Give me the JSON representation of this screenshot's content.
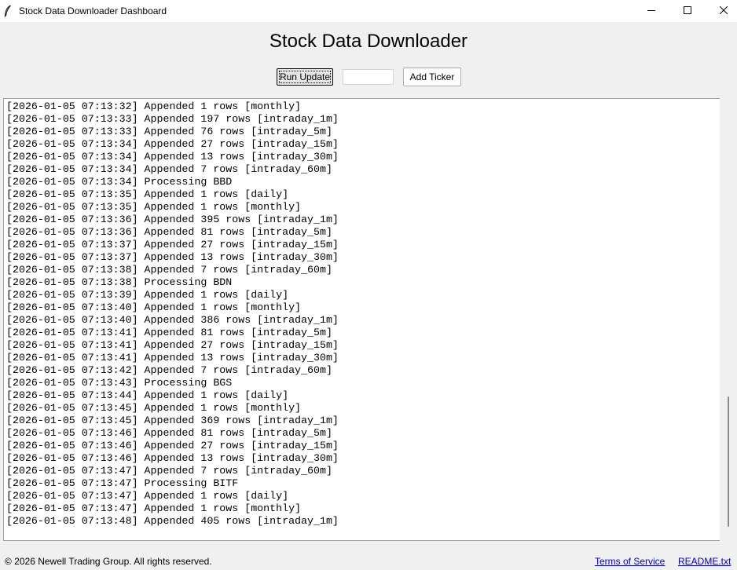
{
  "window": {
    "title": "Stock Data Downloader Dashboard"
  },
  "header": {
    "title": "Stock Data Downloader"
  },
  "toolbar": {
    "run_label": "Run Update",
    "ticker_value": "",
    "add_label": "Add Ticker"
  },
  "log": {
    "lines": [
      "[2026-01-05 07:13:32] Appended 1 rows [monthly]",
      "[2026-01-05 07:13:33] Appended 197 rows [intraday_1m]",
      "[2026-01-05 07:13:33] Appended 76 rows [intraday_5m]",
      "[2026-01-05 07:13:34] Appended 27 rows [intraday_15m]",
      "[2026-01-05 07:13:34] Appended 13 rows [intraday_30m]",
      "[2026-01-05 07:13:34] Appended 7 rows [intraday_60m]",
      "[2026-01-05 07:13:34] Processing BBD",
      "[2026-01-05 07:13:35] Appended 1 rows [daily]",
      "[2026-01-05 07:13:35] Appended 1 rows [monthly]",
      "[2026-01-05 07:13:36] Appended 395 rows [intraday_1m]",
      "[2026-01-05 07:13:36] Appended 81 rows [intraday_5m]",
      "[2026-01-05 07:13:37] Appended 27 rows [intraday_15m]",
      "[2026-01-05 07:13:37] Appended 13 rows [intraday_30m]",
      "[2026-01-05 07:13:38] Appended 7 rows [intraday_60m]",
      "[2026-01-05 07:13:38] Processing BDN",
      "[2026-01-05 07:13:39] Appended 1 rows [daily]",
      "[2026-01-05 07:13:40] Appended 1 rows [monthly]",
      "[2026-01-05 07:13:40] Appended 386 rows [intraday_1m]",
      "[2026-01-05 07:13:41] Appended 81 rows [intraday_5m]",
      "[2026-01-05 07:13:41] Appended 27 rows [intraday_15m]",
      "[2026-01-05 07:13:41] Appended 13 rows [intraday_30m]",
      "[2026-01-05 07:13:42] Appended 7 rows [intraday_60m]",
      "[2026-01-05 07:13:43] Processing BGS",
      "[2026-01-05 07:13:44] Appended 1 rows [daily]",
      "[2026-01-05 07:13:45] Appended 1 rows [monthly]",
      "[2026-01-05 07:13:45] Appended 369 rows [intraday_1m]",
      "[2026-01-05 07:13:46] Appended 81 rows [intraday_5m]",
      "[2026-01-05 07:13:46] Appended 27 rows [intraday_15m]",
      "[2026-01-05 07:13:46] Appended 13 rows [intraday_30m]",
      "[2026-01-05 07:13:47] Appended 7 rows [intraday_60m]",
      "[2026-01-05 07:13:47] Processing BITF",
      "[2026-01-05 07:13:47] Appended 1 rows [daily]",
      "[2026-01-05 07:13:47] Appended 1 rows [monthly]",
      "[2026-01-05 07:13:48] Appended 405 rows [intraday_1m]"
    ]
  },
  "footer": {
    "copyright": "© 2026 Newell Trading Group. All rights reserved.",
    "terms_label": "Terms of Service",
    "readme_label": "README.txt"
  },
  "icons": {
    "app": "feather-icon",
    "minimize": "minimize-icon",
    "maximize": "maximize-icon",
    "close": "close-icon"
  },
  "colors": {
    "link": "#0000cc",
    "background": "#f0f0f0"
  }
}
